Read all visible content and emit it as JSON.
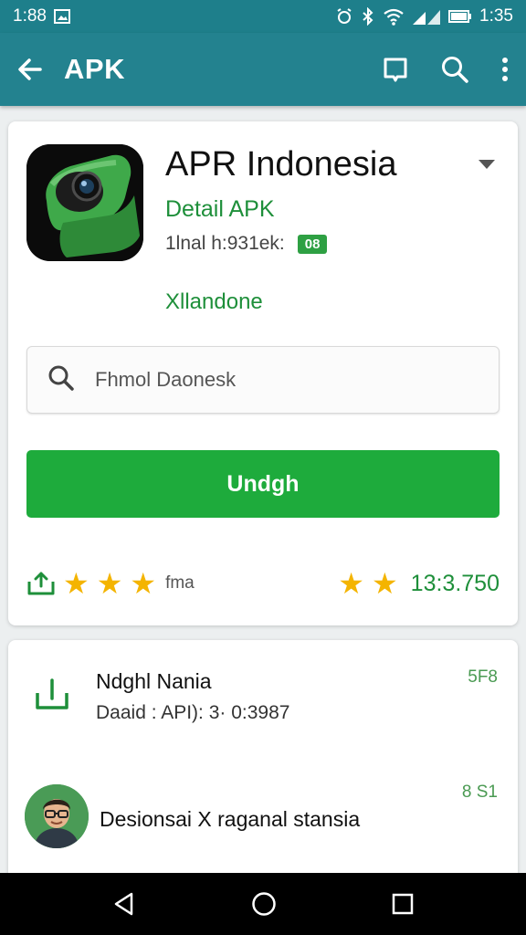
{
  "status_bar": {
    "left_time": "1:88",
    "right_time": "1:35"
  },
  "app_bar": {
    "title": "APK"
  },
  "app": {
    "name": "APR Indonesia",
    "detail_link": "Detail APK",
    "meta": "1lnal h:931ek:",
    "badge": "08",
    "developer": "Xllandone"
  },
  "search": {
    "placeholder": "Fhmol Daonesk"
  },
  "download_button": {
    "label": "Undgh"
  },
  "rating": {
    "label": "fma",
    "count": "13:3.750",
    "left_stars": 3,
    "right_stars": 2
  },
  "list": [
    {
      "title": "Ndghl Nania",
      "subtitle": "Daaid : API): 3· 0:3987",
      "badge": "5F8"
    },
    {
      "text": "Desionsai  X  raganal stansia",
      "badge": "8 S1"
    }
  ],
  "colors": {
    "teal": "#23828f",
    "green": "#1eab3c",
    "link_green": "#1e8f3a",
    "star": "#f4b400"
  },
  "icons": [
    "back-arrow-icon",
    "bookmark-icon",
    "search-icon",
    "more-vert-icon",
    "share-icon",
    "download-icon",
    "nav-back-icon",
    "nav-home-icon",
    "nav-recents-icon"
  ]
}
